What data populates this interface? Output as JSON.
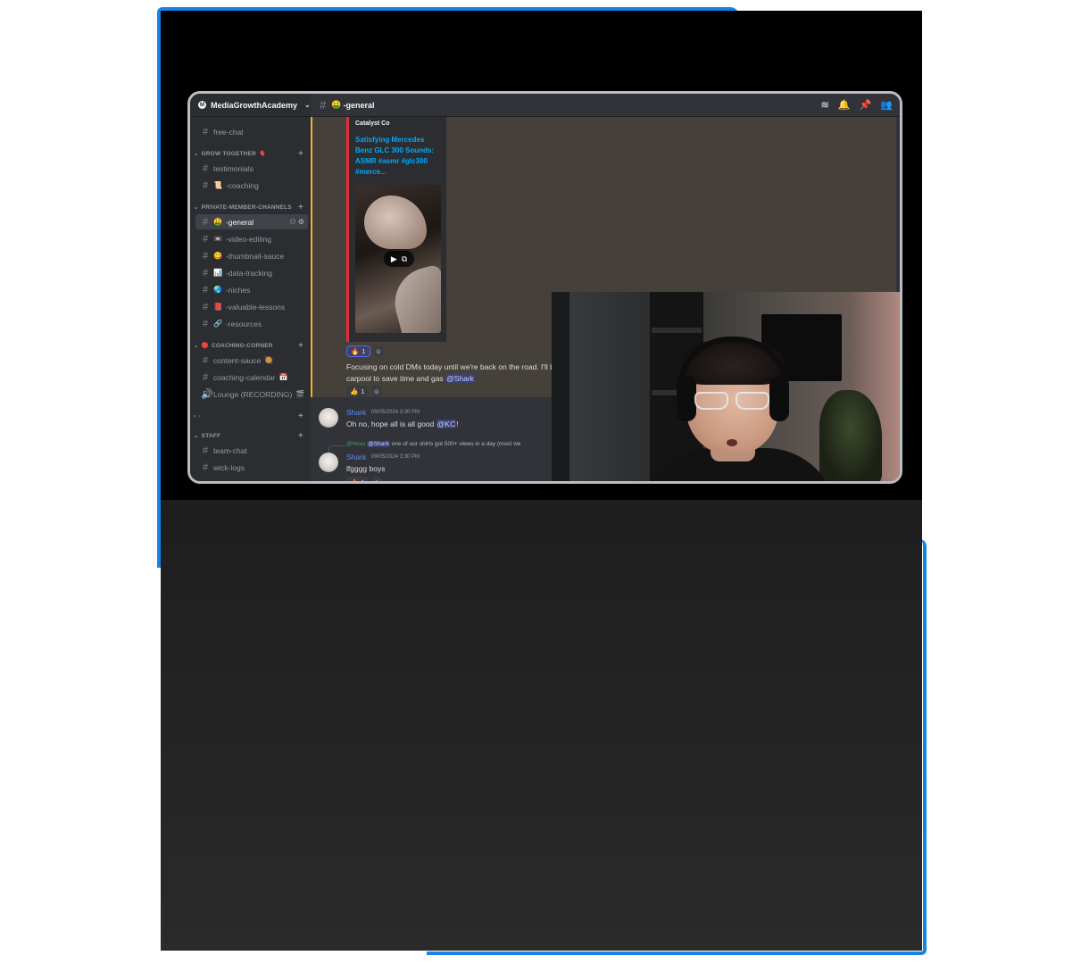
{
  "server": {
    "name": "MediaGrowthAcademy",
    "channels": [
      {
        "label": "free-chat",
        "emoji": ""
      },
      {
        "label": "testimonials",
        "emoji": ""
      },
      {
        "label": "-coaching",
        "emoji": "📜"
      },
      {
        "label": "-general",
        "emoji": "🤑"
      },
      {
        "label": "-video-editing",
        "emoji": "📼"
      },
      {
        "label": "-thumbnail-sauce",
        "emoji": "😋"
      },
      {
        "label": "-data-tracking",
        "emoji": "📊"
      },
      {
        "label": "-niches",
        "emoji": "🌏"
      },
      {
        "label": "-valuable-lessons",
        "emoji": "📕"
      },
      {
        "label": "-resources",
        "emoji": "🔗"
      },
      {
        "label": "content-sauce",
        "emoji": "🥘"
      },
      {
        "label": "coaching-calendar",
        "emoji": "📅"
      },
      {
        "label": "Lounge (RECORDING)",
        "emoji": "🎬"
      },
      {
        "label": "team-chat",
        "emoji": ""
      },
      {
        "label": "wick-logs",
        "emoji": ""
      }
    ],
    "categories": [
      {
        "label": "GROW TOGETHER",
        "emoji": "🫀"
      },
      {
        "label": "PRIVATE-MEMBER-CHANNELS",
        "emoji": ""
      },
      {
        "label": "COACHING-CORNER",
        "emoji": "🔴"
      },
      {
        "label": "-",
        "emoji": ""
      },
      {
        "label": "STAFF",
        "emoji": ""
      }
    ]
  },
  "channel_header": {
    "name": "-general",
    "emoji": "🤑"
  },
  "embed": {
    "author": "Catalyst Co",
    "title": "Satisfying Mercedes Benz GLC 300 Sounds: ASMR #asmr #glc300 #merce..."
  },
  "messages": {
    "m1_reaction": {
      "emoji": "🔥",
      "count": "1"
    },
    "m1_text_line1": "Focusing on cold DMs today until we're back on the road. I'll b",
    "m1_text_line2": "carpool to save time and gas",
    "m1_mention": "@Shark",
    "m1_reaction2": {
      "emoji": "👍",
      "count": "1"
    },
    "m2_author": "Shark",
    "m2_time": "09/05/2024 3:30 PM",
    "m2_text": "Oh no, hope all is all good",
    "m2_mention": "@KC",
    "m2_suffix": "!",
    "m3_reply_name": "@Hxsu",
    "m3_reply_mention": "@Shark",
    "m3_reply_text": "one of our shirts got 500+ views in a day (most vie",
    "m3_author": "Shark",
    "m3_time": "09/05/2024 3:30 PM",
    "m3_text": "lfgggg boys",
    "m3_reaction": {
      "emoji": "🔥",
      "count": "1"
    }
  },
  "icons": [
    "threads-icon",
    "bell-icon",
    "pin-icon",
    "members-icon",
    "hash-icon",
    "plus-icon",
    "chevron-down-icon",
    "add-reaction-icon",
    "play-icon"
  ]
}
